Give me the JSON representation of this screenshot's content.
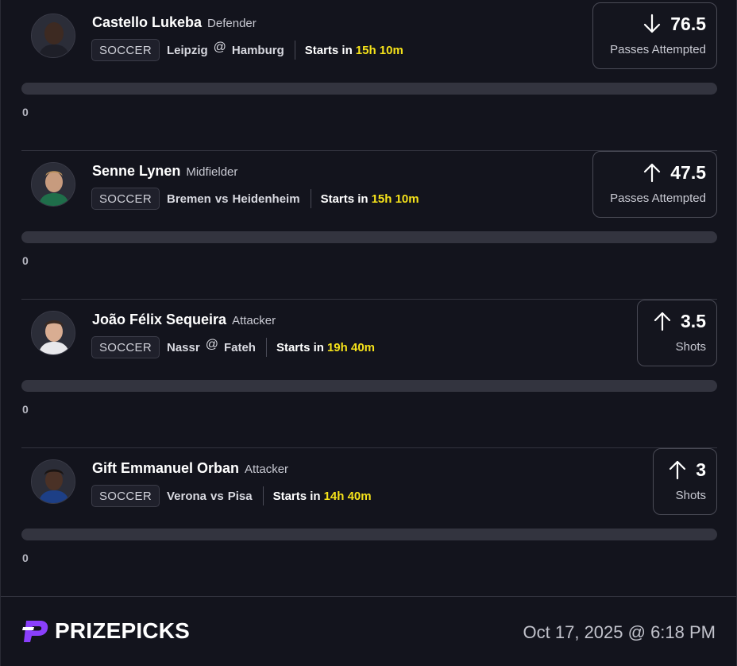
{
  "colors": {
    "background": "#13141d",
    "accent_time": "#f5e21a",
    "brand_purple": "#8a3ffc",
    "divider": "#33343f"
  },
  "picks": [
    {
      "player": "Castello Lukeba",
      "position": "Defender",
      "sport": "SOCCER",
      "team_a": "Leipzig",
      "matchup_separator": "@",
      "team_b": "Hamburg",
      "starts_label": "Starts in",
      "starts_time": "15h 10m",
      "direction": "down",
      "direction_icon": "arrow-down-icon",
      "line": "76.5",
      "stat_type": "Passes Attempted",
      "current_value": "0",
      "progress": 0
    },
    {
      "player": "Senne Lynen",
      "position": "Midfielder",
      "sport": "SOCCER",
      "team_a": "Bremen",
      "matchup_separator": "vs",
      "team_b": "Heidenheim",
      "starts_label": "Starts in",
      "starts_time": "15h 10m",
      "direction": "up",
      "direction_icon": "arrow-up-icon",
      "line": "47.5",
      "stat_type": "Passes Attempted",
      "current_value": "0",
      "progress": 0
    },
    {
      "player": "João Félix Sequeira",
      "position": "Attacker",
      "sport": "SOCCER",
      "team_a": "Nassr",
      "matchup_separator": "@",
      "team_b": "Fateh",
      "starts_label": "Starts in",
      "starts_time": "19h 40m",
      "direction": "up",
      "direction_icon": "arrow-up-icon",
      "line": "3.5",
      "stat_type": "Shots",
      "current_value": "0",
      "progress": 0
    },
    {
      "player": "Gift Emmanuel Orban",
      "position": "Attacker",
      "sport": "SOCCER",
      "team_a": "Verona",
      "matchup_separator": "vs",
      "team_b": "Pisa",
      "starts_label": "Starts in",
      "starts_time": "14h 40m",
      "direction": "up",
      "direction_icon": "arrow-up-icon",
      "line": "3",
      "stat_type": "Shots",
      "current_value": "0",
      "progress": 0
    }
  ],
  "footer": {
    "brand": "PRIZEPICKS",
    "brand_icon": "prizepicks-logo-icon",
    "timestamp": "Oct 17, 2025 @ 6:18 PM"
  }
}
